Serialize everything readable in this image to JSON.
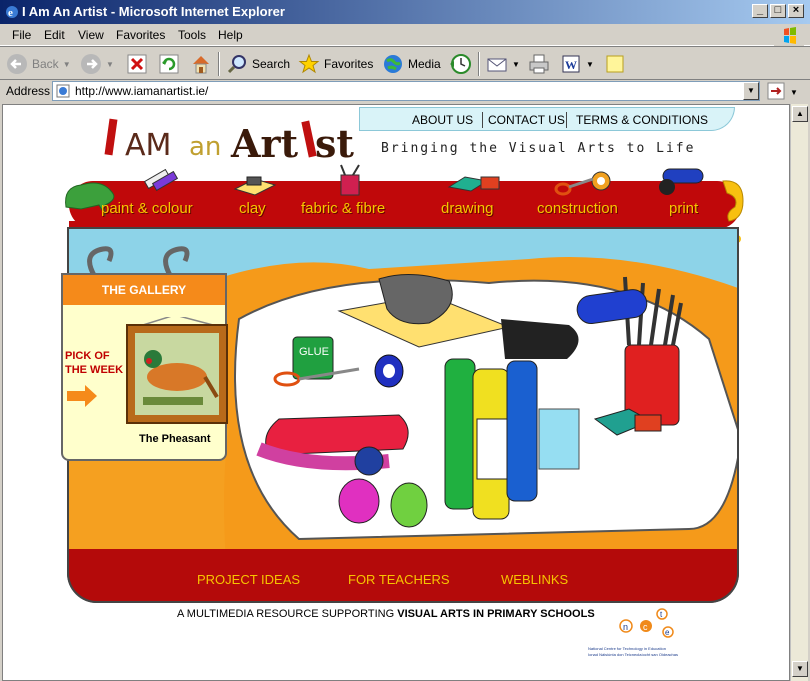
{
  "window": {
    "title": "I Am An Artist - Microsoft Internet Explorer"
  },
  "menu": [
    "File",
    "Edit",
    "View",
    "Favorites",
    "Tools",
    "Help"
  ],
  "toolbar": {
    "back": "Back",
    "search": "Search",
    "favorites": "Favorites",
    "media": "Media"
  },
  "address": {
    "label": "Address",
    "url": "http://www.iamanartist.ie/"
  },
  "site": {
    "top_nav": [
      "ABOUT US",
      "CONTACT US",
      "TERMS & CONDITIONS"
    ],
    "logo_text": "I AM an ArtIst",
    "tagline": "Bringing the Visual Arts to Life",
    "categories": [
      "paint & colour",
      "clay",
      "fabric & fibre",
      "drawing",
      "construction",
      "print"
    ],
    "gallery_title": "THE GALLERY",
    "pick_of_week": "PICK OF THE WEEK",
    "picture_caption": "The Pheasant",
    "bottom_links": [
      "PROJECT IDEAS",
      "FOR TEACHERS",
      "WEBLINKS"
    ],
    "footer_prefix": "A MULTIMEDIA RESOURCE SUPPORTING ",
    "footer_bold": "VISUAL ARTS IN PRIMARY SCHOOLS",
    "glue_label": "GLUE",
    "ncte_line1": "National Centre for Technology in Education",
    "ncte_line2": "Ionad Náisiúnta don Teicneolaíocht san Oideachas"
  }
}
